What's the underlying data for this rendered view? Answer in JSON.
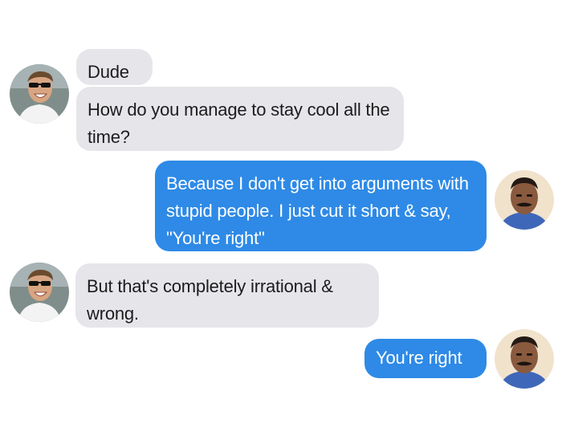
{
  "conversation": {
    "messages": [
      {
        "sender": "friend",
        "text": "Dude"
      },
      {
        "sender": "friend",
        "text": "How do you manage to stay cool all the time?"
      },
      {
        "sender": "me",
        "text": "Because I don't get into arguments with stupid people. I just cut it short & say, \"You're right\""
      },
      {
        "sender": "friend",
        "text": "But that's completely irrational & wrong."
      },
      {
        "sender": "me",
        "text": "You're right"
      }
    ]
  },
  "colors": {
    "incoming_bubble": "#e6e5ea",
    "outgoing_bubble": "#2e8ae6",
    "incoming_text": "#1c1c1c",
    "outgoing_text": "#ffffff"
  },
  "avatars": {
    "friend": "sunglasses-laughing-man-avatar",
    "me": "mustached-man-avatar"
  }
}
